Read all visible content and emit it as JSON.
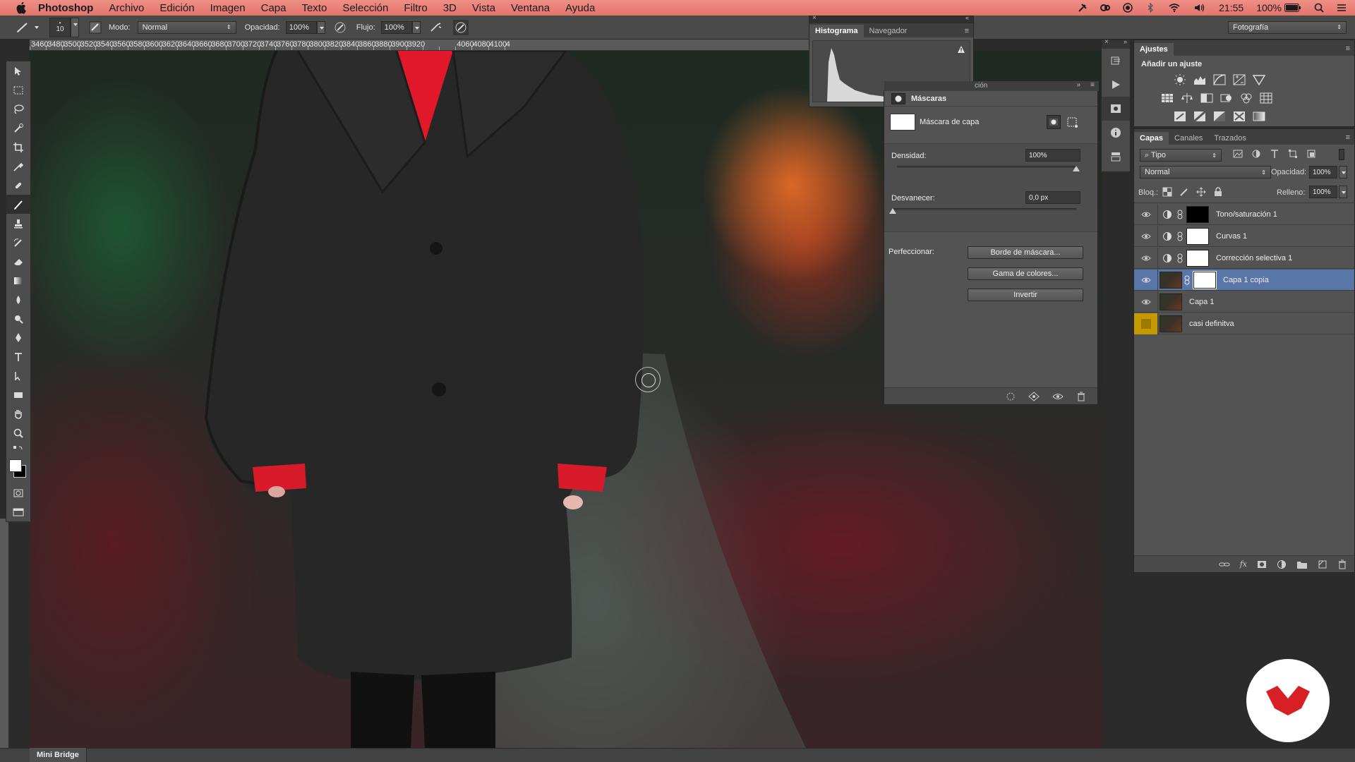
{
  "menubar": {
    "app": "Photoshop",
    "items": [
      "Archivo",
      "Edición",
      "Imagen",
      "Capa",
      "Texto",
      "Selección",
      "Filtro",
      "3D",
      "Vista",
      "Ventana",
      "Ayuda"
    ],
    "time": "21:55",
    "battery": "100%"
  },
  "options": {
    "brush_size": "10",
    "mode_label": "Modo:",
    "mode_value": "Normal",
    "opacity_label": "Opacidad:",
    "opacity_value": "100%",
    "flow_label": "Flujo:",
    "flow_value": "100%",
    "workspace": "Fotografía"
  },
  "ruler": {
    "labels": [
      "3460",
      "3480",
      "3500",
      "3520",
      "3540",
      "3560",
      "3580",
      "3600",
      "3620",
      "3640",
      "3660",
      "3680",
      "3700",
      "3720",
      "3740",
      "3760",
      "3780",
      "3800",
      "3820",
      "3840",
      "3860",
      "3880",
      "3900",
      "3920",
      "",
      "",
      "4060",
      "4080",
      "4100",
      "4"
    ]
  },
  "histogram": {
    "tabs": [
      "Histograma",
      "Navegador"
    ]
  },
  "masks": {
    "partial_tab": "ción",
    "title": "Máscaras",
    "mask_type": "Máscara de capa",
    "density_label": "Densidad:",
    "density_value": "100%",
    "density_fraction": 1.0,
    "feather_label": "Desvanecer:",
    "feather_value": "0,0 px",
    "feather_fraction": 0.0,
    "refine_label": "Perfeccionar:",
    "buttons": [
      "Borde de máscara...",
      "Gama de colores...",
      "Invertir"
    ]
  },
  "adjustments": {
    "tab": "Ajustes",
    "subtitle": "Añadir un ajuste"
  },
  "layers": {
    "tabs": [
      "Capas",
      "Canales",
      "Trazados"
    ],
    "filter_kind": "Tipo",
    "blend_mode": "Normal",
    "opacity_label": "Opacidad:",
    "opacity_value": "100%",
    "lock_label": "Bloq.:",
    "fill_label": "Relleno:",
    "fill_value": "100%",
    "items": [
      {
        "name": "Tono/saturación 1",
        "kind": "adjustment",
        "mask": "black"
      },
      {
        "name": "Curvas 1",
        "kind": "adjustment",
        "mask": "white"
      },
      {
        "name": "Corrección selectiva 1",
        "kind": "adjustment",
        "mask": "white"
      },
      {
        "name": "Capa 1 copia",
        "kind": "pixel-with-mask",
        "mask": "white",
        "selected": true
      },
      {
        "name": "Capa 1",
        "kind": "pixel"
      },
      {
        "name": "casi definitva",
        "kind": "pixel",
        "color_tag": "#c49a00"
      }
    ]
  },
  "bottom": {
    "mini_bridge": "Mini Bridge"
  },
  "colors": {
    "menubar": "#e7796f",
    "selection": "#5877a8",
    "logo_red": "#d81f26"
  }
}
